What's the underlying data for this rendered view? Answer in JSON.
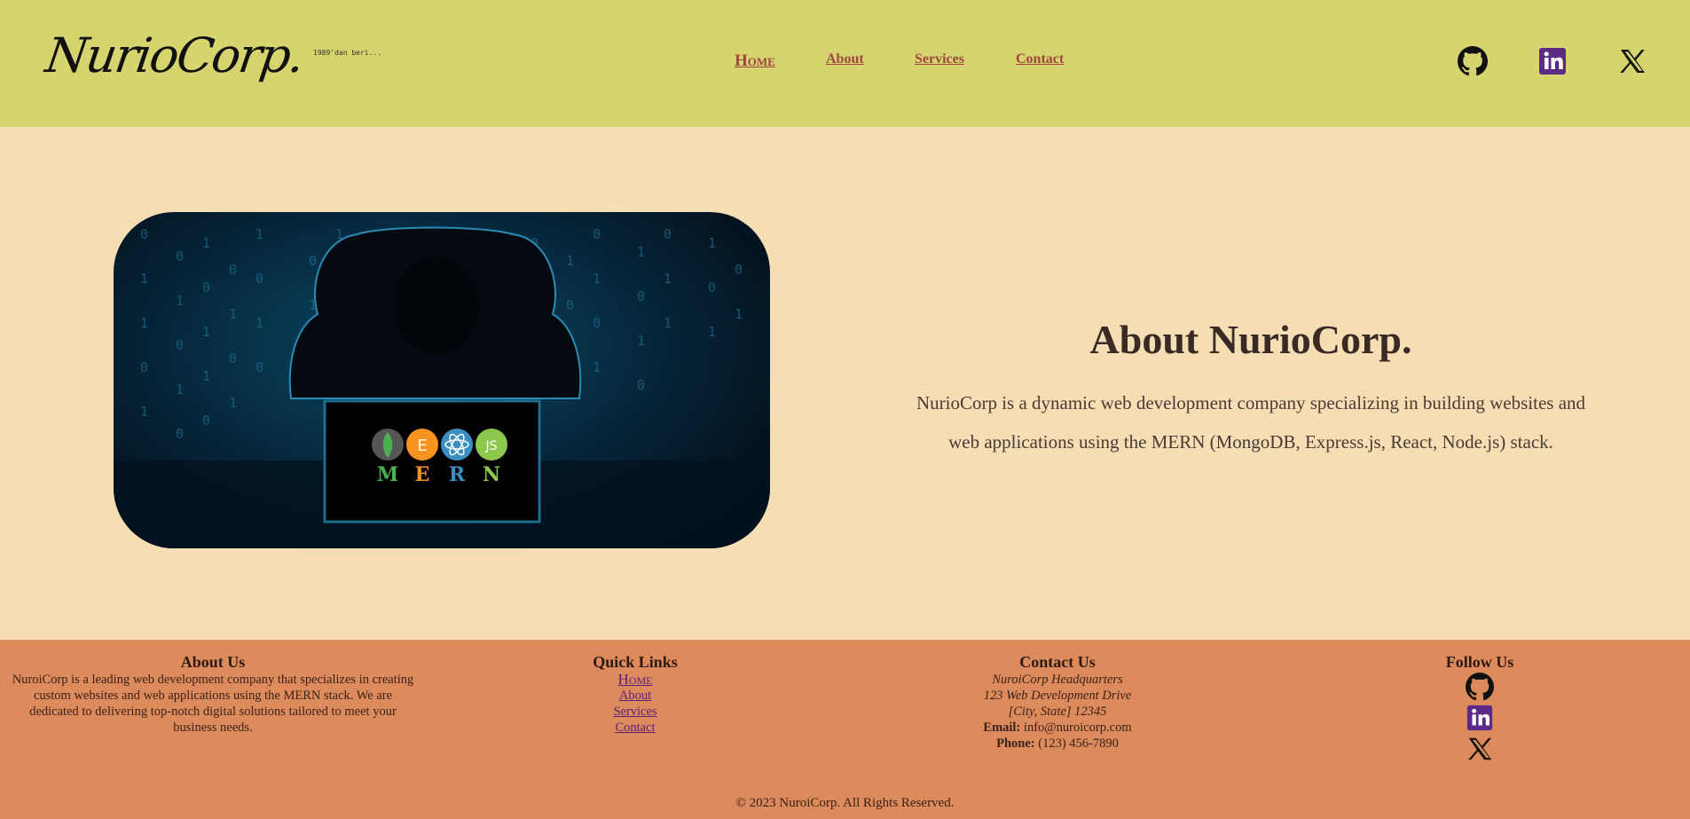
{
  "header": {
    "logo_text": "NurioCorp.",
    "logo_tagline": "1989'dan beri...",
    "nav": [
      "Home",
      "About",
      "Services",
      "Contact"
    ],
    "social_icons": [
      "github-icon",
      "linkedin-icon",
      "x-icon"
    ]
  },
  "hero": {
    "image_badges": [
      "M",
      "E",
      "R",
      "N"
    ],
    "title": "About NurioCorp.",
    "text": "NurioCorp is a dynamic web development company specializing in building websites and web applications using the MERN (MongoDB, Express.js, React, Node.js) stack."
  },
  "footer": {
    "about": {
      "title": "About Us",
      "text": "NuroiCorp is a leading web development company that specializes in creating custom websites and web applications using the MERN stack. We are dedicated to delivering top-notch digital solutions tailored to meet your business needs."
    },
    "links": {
      "title": "Quick Links",
      "items": [
        "Home",
        "About",
        "Services",
        "Contact"
      ]
    },
    "contact": {
      "title": "Contact Us",
      "hq": "NuroiCorp Headquarters",
      "street": "123 Web Development Drive",
      "city": "[City, State] 12345",
      "email_label": "Email:",
      "email": "info@nuroicorp.com",
      "phone_label": "Phone:",
      "phone": "(123) 456-7890"
    },
    "follow": {
      "title": "Follow Us"
    },
    "copyright": "© 2023 NuroiCorp. All Rights Reserved."
  },
  "colors": {
    "header_bg": "#d6d46e",
    "main_bg": "#f5deb3",
    "footer_bg": "#dd8a5c",
    "nav_link": "#a0453d",
    "linkedin": "#5b2a86"
  }
}
